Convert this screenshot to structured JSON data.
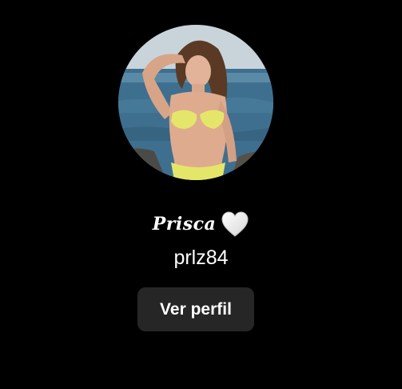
{
  "profile": {
    "display_name": "Prisca",
    "username": "prlz84",
    "name_emoji_icon": "white-heart-icon",
    "avatar_description_icon": "profile-photo"
  },
  "actions": {
    "view_profile_label": "Ver perfil"
  },
  "colors": {
    "background": "#000000",
    "button_background": "#262626",
    "text": "#ffffff"
  }
}
